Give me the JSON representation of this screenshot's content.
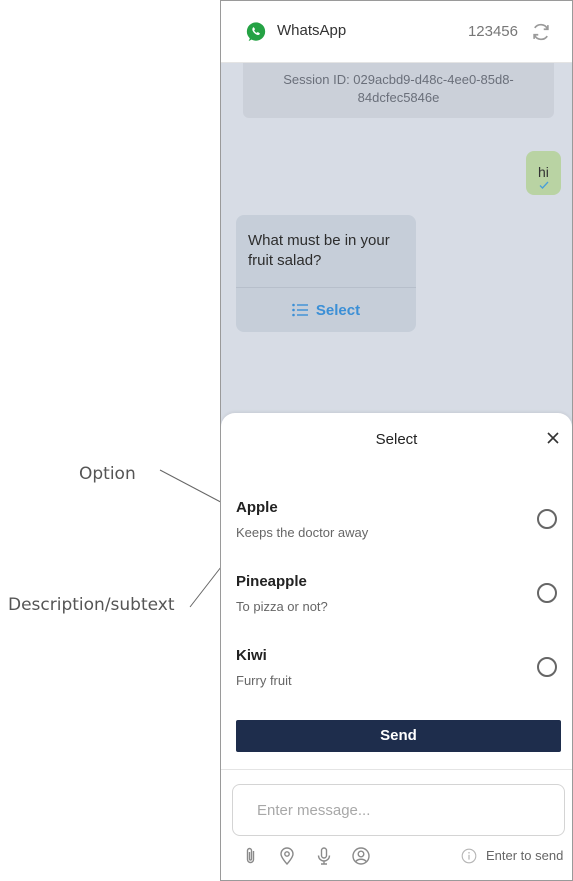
{
  "annotations": {
    "option_label": "Option",
    "description_label": "Description/subtext"
  },
  "header": {
    "app_name": "WhatsApp",
    "number": "123456",
    "icons": [
      "whatsapp-logo",
      "refresh-icon"
    ]
  },
  "chat": {
    "session_text": "Session ID: 029acbd9-d48c-4ee0-85d8-84dcfec5846e",
    "outgoing_message": "hi",
    "incoming_message": "What must be in your fruit salad?",
    "select_button_label": "Select"
  },
  "sheet": {
    "title": "Select",
    "options": [
      {
        "title": "Apple",
        "description": "Keeps the doctor away",
        "selected": false
      },
      {
        "title": "Pineapple",
        "description": "To pizza or not?",
        "selected": false
      },
      {
        "title": "Kiwi",
        "description": "Furry fruit",
        "selected": false
      }
    ],
    "send_label": "Send"
  },
  "composer": {
    "placeholder": "Enter message...",
    "hint": "Enter to send",
    "icons": [
      "paperclip-icon",
      "location-icon",
      "microphone-icon",
      "contact-icon",
      "info-icon"
    ]
  },
  "colors": {
    "chat_background": "#d7dce5",
    "outgoing_bubble": "#b9d3a3",
    "incoming_bubble": "#c6ced9",
    "send_button": "#1e2d4c",
    "accent_link": "#3b8fd6",
    "whatsapp_green": "#25a244"
  }
}
